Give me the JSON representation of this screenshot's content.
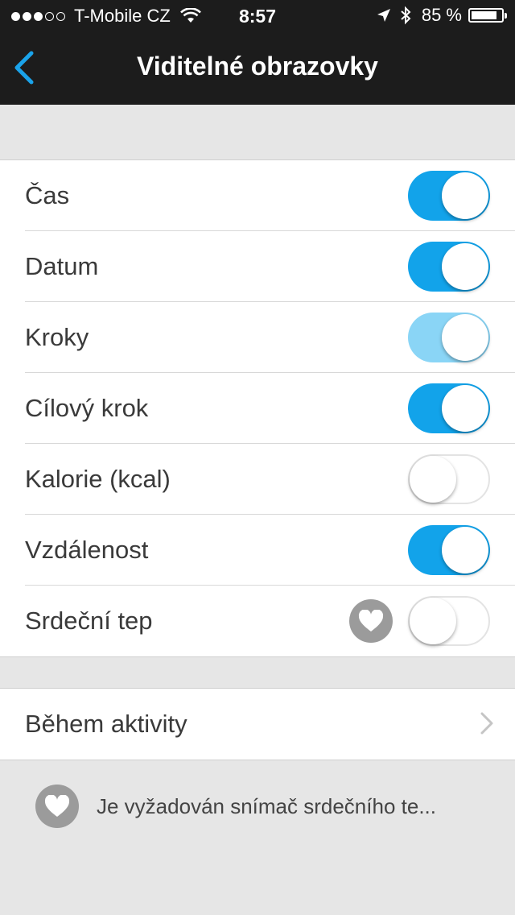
{
  "status_bar": {
    "carrier": "T-Mobile CZ",
    "time": "8:57",
    "battery": "85 %",
    "battery_level": 0.85,
    "signal_bars_filled": 3,
    "signal_bars_total": 5
  },
  "nav": {
    "title": "Viditelné obrazovky",
    "back_icon": "chevron-left-icon"
  },
  "accent_color": "#12a3ea",
  "screens": [
    {
      "label": "Čas",
      "on": true
    },
    {
      "label": "Datum",
      "on": true
    },
    {
      "label": "Kroky",
      "on": true
    },
    {
      "label": "Cílový krok",
      "on": true
    },
    {
      "label": "Kalorie (kcal)",
      "on": false
    },
    {
      "label": "Vzdálenost",
      "on": true
    },
    {
      "label": "Srdeční tep",
      "on": false,
      "icon": "heart-icon"
    }
  ],
  "activity": {
    "label": "Během aktivity",
    "icon": "chevron-right-icon"
  },
  "footer": {
    "note": "Je vyžadován snímač srdečního te...",
    "icon": "heart-icon"
  }
}
